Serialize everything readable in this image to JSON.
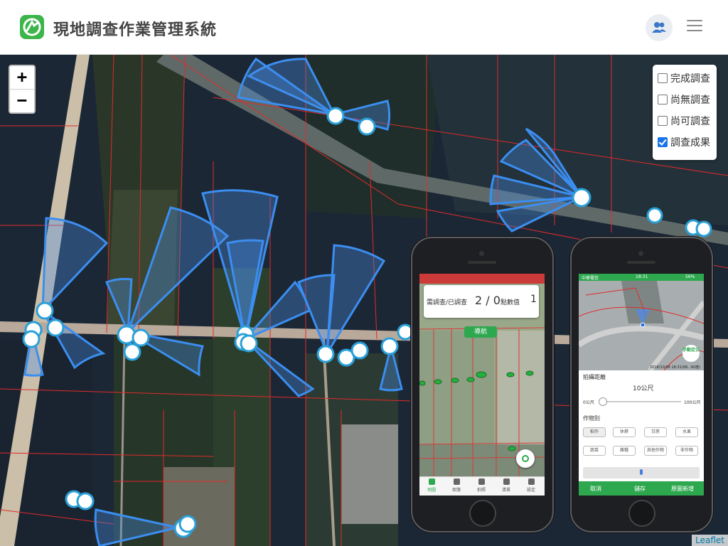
{
  "header": {
    "title": "現地調查作業管理系統",
    "brand_color": "#3cb54a"
  },
  "icons": {
    "logo": "app-logo-icon",
    "user": "users-icon",
    "menu": "hamburger-menu-icon"
  },
  "map": {
    "zoom_in": "+",
    "zoom_out": "−",
    "attribution": "Leaflet",
    "marker_color": "#3b8ef0",
    "parcel_line_color": "#e02b2b"
  },
  "layers": [
    {
      "label": "完成調查",
      "checked": false
    },
    {
      "label": "尚無調查",
      "checked": false
    },
    {
      "label": "尚可調查",
      "checked": false
    },
    {
      "label": "調查成果",
      "checked": true
    }
  ],
  "phone1": {
    "card_label": "需調查/已調查",
    "card_value": "2 / 0",
    "card_points_label": "點數值",
    "card_points_value": "1",
    "nav_button": "導航",
    "tabs": [
      "地圖",
      "相簿",
      "拍照",
      "清單",
      "設定"
    ]
  },
  "phone2": {
    "status_left": "中華電信",
    "status_time": "18:31",
    "status_right": "56%",
    "manual_locate": "手動定位",
    "timestamp": "2018/10/06 18:31(68...60度)",
    "distance_label": "拍攝距離",
    "distance_value": "10公尺",
    "slider_min": "0公尺",
    "slider_max": "100公尺",
    "crop_label": "作物別",
    "crops": [
      "稻作",
      "休耕",
      "甘蔗",
      "水果",
      "蔬菜",
      "雜糧",
      "其他作物",
      "非作物"
    ],
    "actions": [
      "取消",
      "儲存",
      "原圖新增"
    ]
  }
}
